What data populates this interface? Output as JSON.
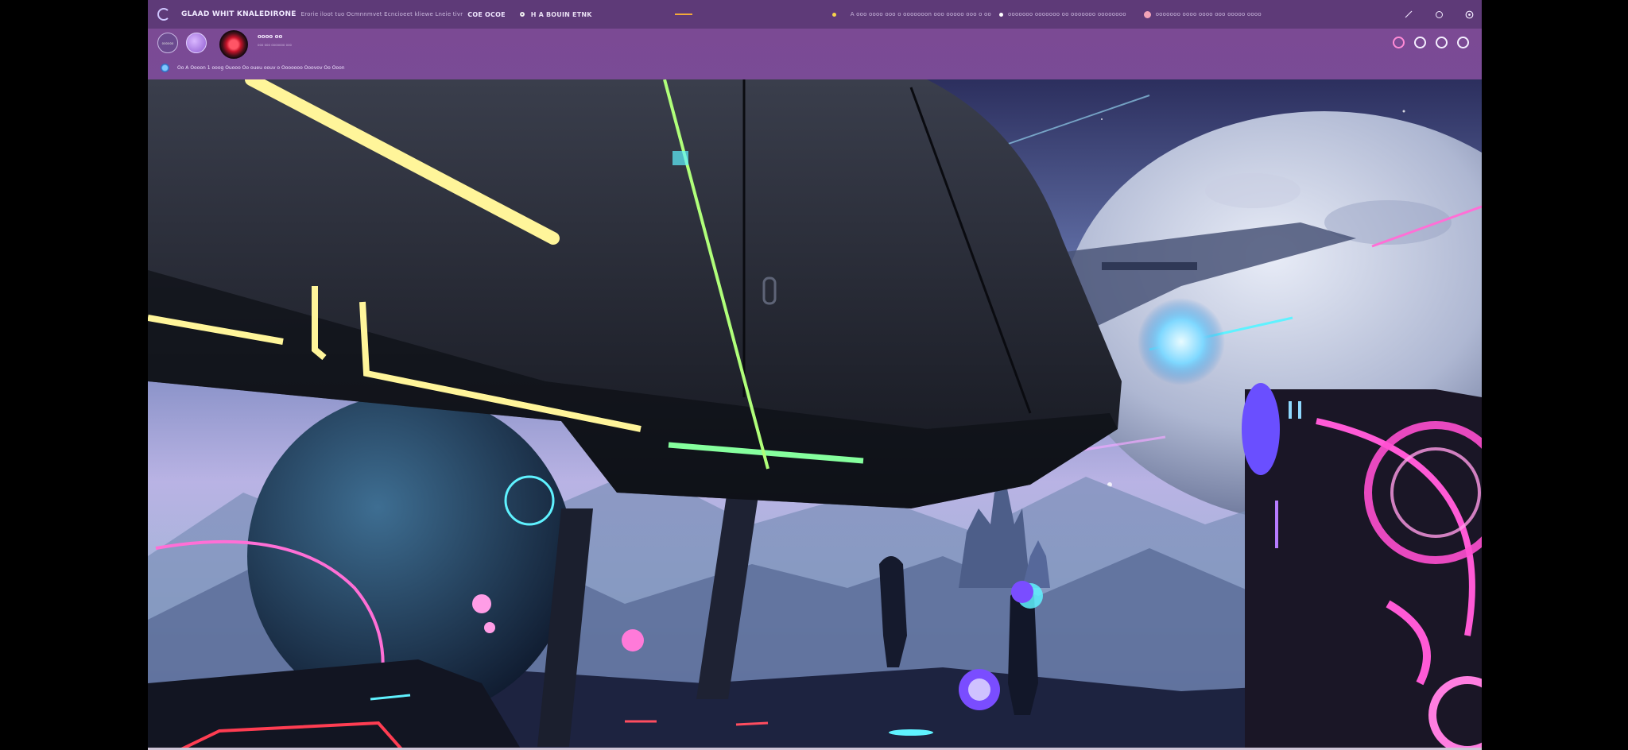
{
  "app": {
    "title": "GLAAD WHIT KNALEDIRONE",
    "title_extra": "Erorie iloot tuo  Ocmnnmvet  Ecncioeet  kliewe  Lneie tivr",
    "title_tag": "COE OCOE",
    "nav_link": "H A BOUIN ETNK",
    "center_text_1": "A ooo  oooo  ooo  o  ooooooon  ooo  ooooo  ooo o  oo",
    "center_text_2": "ooooooo ooooooo oo ooooooo oooooooo",
    "right_text": "ooooooo  oooo  oooo  ooo  ooooo  oooo"
  },
  "colors": {
    "titlebar": "#5e3a78",
    "subbar": "#7b4a94",
    "accent_pink": "#ff8ad6",
    "record_red": "#e0182f",
    "status_blue": "#4aa3ff"
  },
  "profile": {
    "avatar1_label": "oooooo",
    "name": "oooo oo",
    "subtitle": "ooo ooo ooooooo ooo"
  },
  "status": {
    "text": "Oo A Oooon  1 ooog  Ouooo Oo oueu  oouv o Ooooooo  Ooovov  Oo Ooon"
  },
  "icons": {
    "logo": "logo-icon",
    "edit": "pencil-icon",
    "user": "user-circle-icon",
    "settings": "gear-icon"
  }
}
